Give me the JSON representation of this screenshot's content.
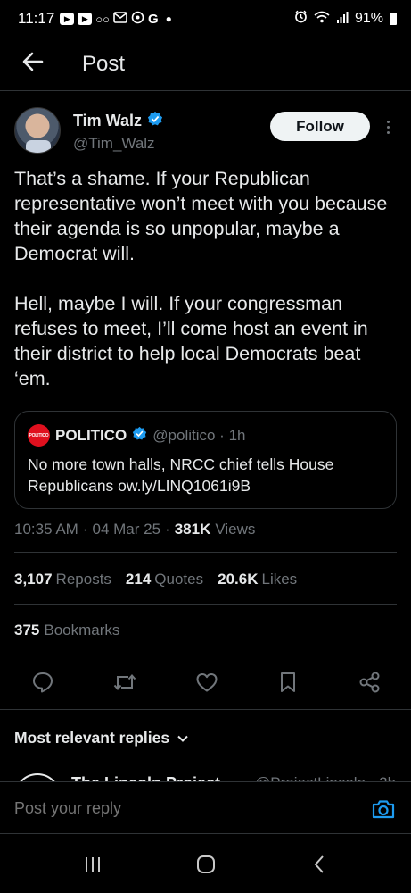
{
  "status_bar": {
    "time": "11:17",
    "battery": "91%",
    "left_icons": [
      "video-icon",
      "youtube-icon",
      "voicemail-icon",
      "gmail-icon",
      "location-icon",
      "google-icon",
      "dot-icon"
    ],
    "right_icons": [
      "alarm-icon",
      "wifi-icon",
      "signal-icon",
      "battery-icon"
    ]
  },
  "header": {
    "title": "Post",
    "back_icon": "back-arrow-icon"
  },
  "author": {
    "name": "Tim Walz",
    "handle": "@Tim_Walz",
    "verified": true,
    "follow_label": "Follow"
  },
  "tweet": {
    "text": "That’s a shame. If your Republican representative won’t meet with you because their agenda is so unpopular, maybe a Democrat will.\n\nHell, maybe I will. If your congressman refuses to meet, I’ll come host an event in their district to help local Democrats beat ‘em."
  },
  "quote": {
    "logo_text": "POLITICO",
    "name": "POLITICO",
    "handle": "@politico · 1h",
    "text": "No more town halls, NRCC chief tells House Republicans ow.ly/LINQ1061i9B"
  },
  "meta": {
    "time": "10:35 AM",
    "sep1": "·",
    "date": "04 Mar 25",
    "sep2": "·",
    "views_count": "381K",
    "views_label": "Views"
  },
  "stats": {
    "reposts_count": "3,107",
    "reposts_label": "Reposts",
    "quotes_count": "214",
    "quotes_label": "Quotes",
    "likes_count": "20.6K",
    "likes_label": "Likes",
    "bookmarks_count": "375",
    "bookmarks_label": "Bookmarks"
  },
  "actions": [
    "reply-icon",
    "repost-icon",
    "like-icon",
    "bookmark-icon",
    "share-icon"
  ],
  "replies": {
    "sort_label": "Most relevant replies",
    "peek_name": "The Lincoln Project",
    "peek_handle": "@ProjectLincoln · 2h"
  },
  "reply_bar": {
    "placeholder": "Post your reply"
  },
  "colors": {
    "background": "#000000",
    "text": "#e7e9ea",
    "muted": "#71767b",
    "accent": "#1d9bf0",
    "divider": "#2f3336",
    "politico_red": "#e0101e"
  }
}
